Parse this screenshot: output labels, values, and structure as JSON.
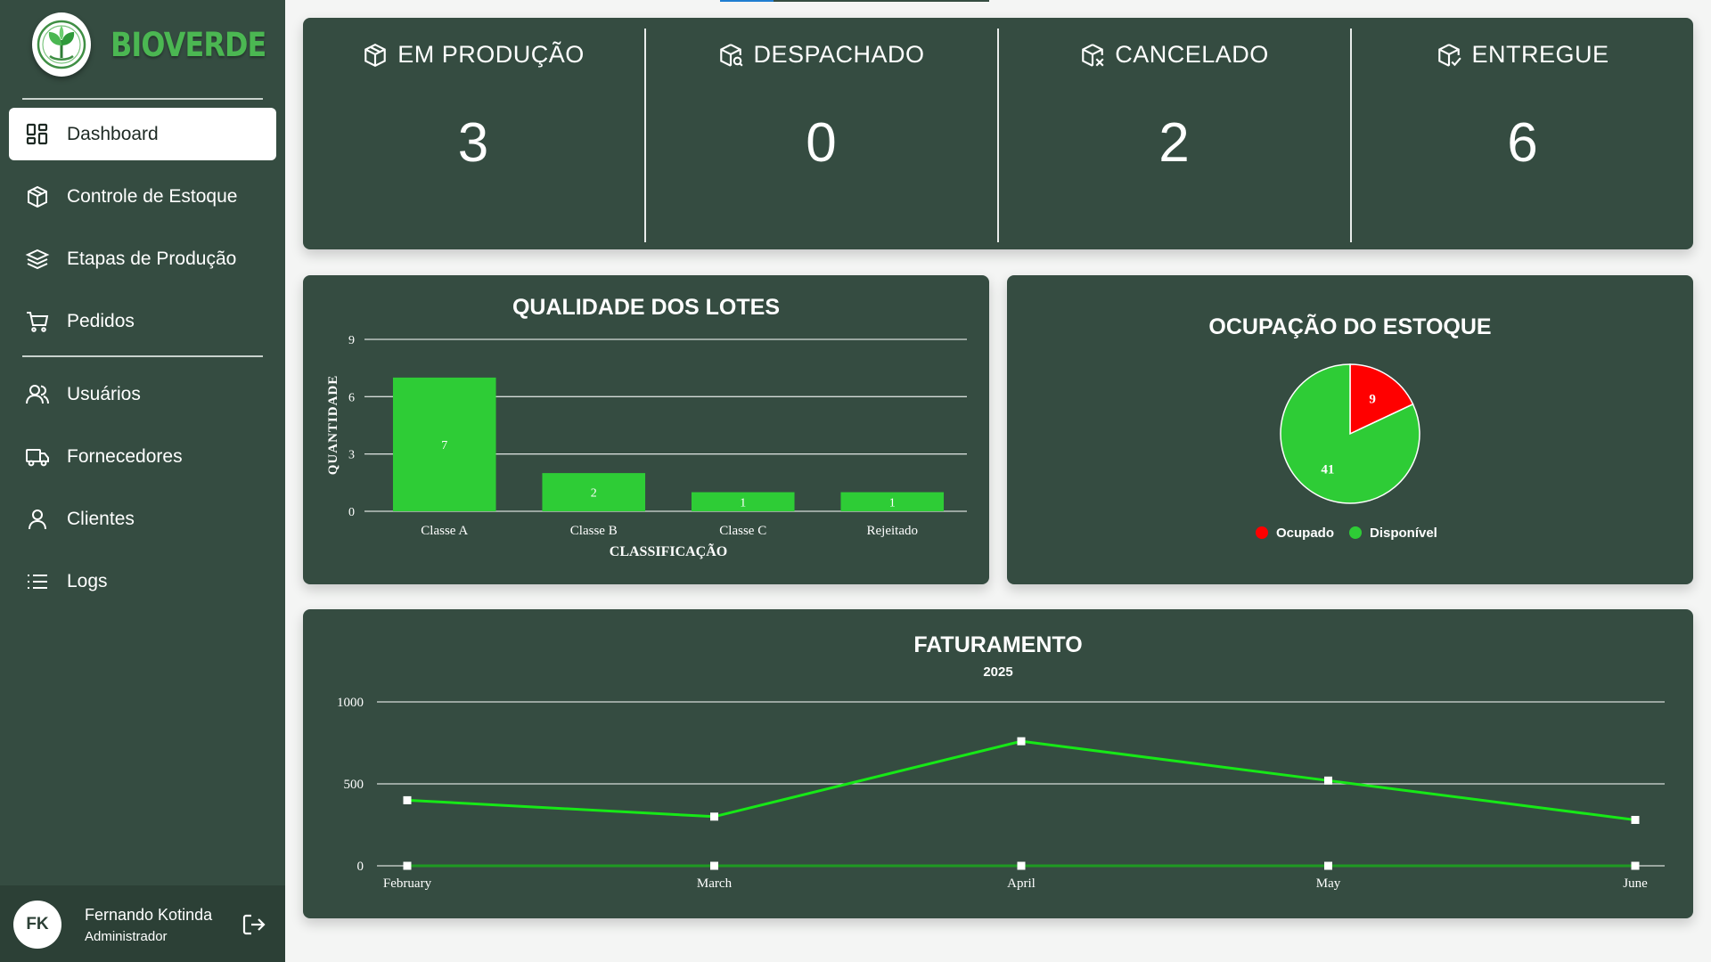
{
  "brand": {
    "name": "BIOVERDE"
  },
  "nav": {
    "items": [
      {
        "label": "Dashboard",
        "icon": "dashboard-icon",
        "active": true
      },
      {
        "label": "Controle de Estoque",
        "icon": "box-icon"
      },
      {
        "label": "Etapas de Produção",
        "icon": "layers-icon"
      },
      {
        "label": "Pedidos",
        "icon": "cart-icon"
      },
      {
        "label": "Usuários",
        "icon": "users-icon"
      },
      {
        "label": "Fornecedores",
        "icon": "truck-icon"
      },
      {
        "label": "Clientes",
        "icon": "user-icon"
      },
      {
        "label": "Logs",
        "icon": "list-icon"
      }
    ]
  },
  "user": {
    "initials": "FK",
    "name": "Fernando Kotinda",
    "role": "Administrador"
  },
  "stats": [
    {
      "label": "EM PRODUÇÃO",
      "value": "3",
      "icon": "package-icon"
    },
    {
      "label": "DESPACHADO",
      "value": "0",
      "icon": "package-search-icon"
    },
    {
      "label": "CANCELADO",
      "value": "2",
      "icon": "package-x-icon"
    },
    {
      "label": "ENTREGUE",
      "value": "6",
      "icon": "package-check-icon"
    }
  ],
  "colors": {
    "sidebar": "#354c41",
    "card": "#354c41",
    "bar": "#2ecc36",
    "occupied": "#ff0000",
    "available": "#2ecc36",
    "line": "#17e817",
    "brand": "#4bb752"
  },
  "chart_data": [
    {
      "type": "bar",
      "title": "QUALIDADE DOS LOTES",
      "xlabel": "CLASSIFICAÇÃO",
      "ylabel": "QUANTIDADE",
      "categories": [
        "Classe A",
        "Classe B",
        "Classe C",
        "Rejeitado"
      ],
      "values": [
        7,
        2,
        1,
        1
      ],
      "ylim": [
        0,
        9
      ],
      "yticks": [
        0,
        3,
        6,
        9
      ],
      "grid": true
    },
    {
      "type": "pie",
      "title": "OCUPAÇÃO DO ESTOQUE",
      "labels": [
        "Ocupado",
        "Disponível"
      ],
      "values": [
        9,
        41
      ],
      "legend": "bottom"
    },
    {
      "type": "line",
      "title": "FATURAMENTO",
      "subtitle": "2025",
      "categories": [
        "February",
        "March",
        "April",
        "May",
        "June"
      ],
      "series": [
        {
          "values": [
            400,
            300,
            760,
            520,
            280
          ]
        },
        {
          "values": [
            0,
            0,
            0,
            0,
            0
          ]
        }
      ],
      "ylim": [
        0,
        1000
      ],
      "yticks": [
        0,
        500,
        1000
      ],
      "grid": true
    }
  ]
}
